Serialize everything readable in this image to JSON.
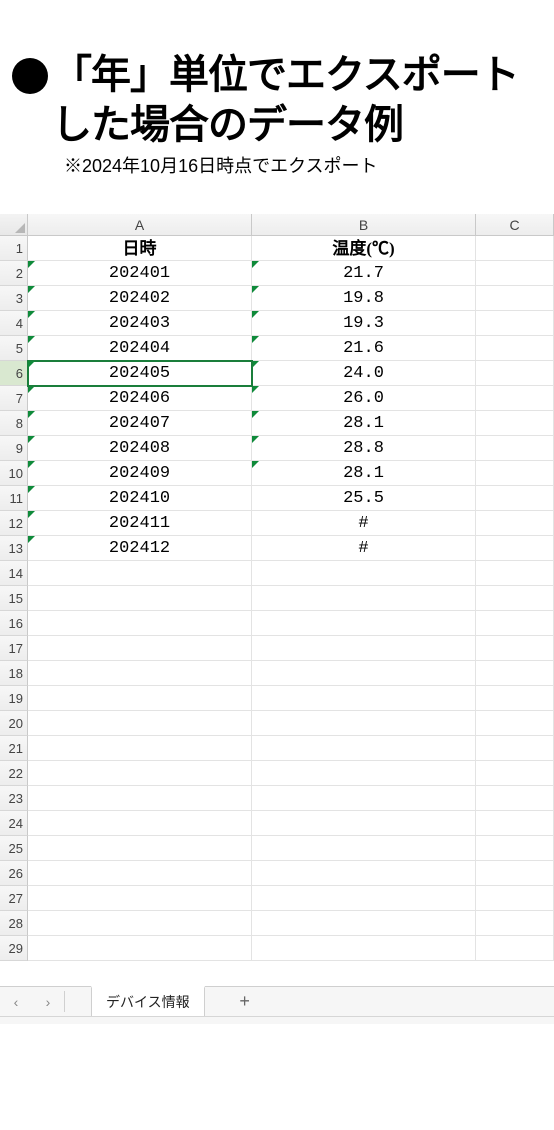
{
  "page": {
    "bullet": "●",
    "title": "「年」単位でエクスポートした場合のデータ例",
    "subtitle": "※2024年10月16日時点でエクスポート"
  },
  "sheet": {
    "columns": [
      "A",
      "B",
      "C"
    ],
    "headers": {
      "A": "日時",
      "B": "温度(℃)"
    },
    "selectedRow": 6,
    "rows": [
      {
        "n": 1,
        "A": "日時",
        "B": "温度(℃)",
        "isHeader": true,
        "flagA": false,
        "flagB": false
      },
      {
        "n": 2,
        "A": "202401",
        "B": "21.7",
        "flagA": true,
        "flagB": true
      },
      {
        "n": 3,
        "A": "202402",
        "B": "19.8",
        "flagA": true,
        "flagB": true
      },
      {
        "n": 4,
        "A": "202403",
        "B": "19.3",
        "flagA": true,
        "flagB": true
      },
      {
        "n": 5,
        "A": "202404",
        "B": "21.6",
        "flagA": true,
        "flagB": true
      },
      {
        "n": 6,
        "A": "202405",
        "B": "24.0",
        "flagA": true,
        "flagB": true
      },
      {
        "n": 7,
        "A": "202406",
        "B": "26.0",
        "flagA": true,
        "flagB": true
      },
      {
        "n": 8,
        "A": "202407",
        "B": "28.1",
        "flagA": true,
        "flagB": true
      },
      {
        "n": 9,
        "A": "202408",
        "B": "28.8",
        "flagA": true,
        "flagB": true
      },
      {
        "n": 10,
        "A": "202409",
        "B": "28.1",
        "flagA": true,
        "flagB": true
      },
      {
        "n": 11,
        "A": "202410",
        "B": "25.5",
        "flagA": true,
        "flagB": false
      },
      {
        "n": 12,
        "A": "202411",
        "B": "#",
        "flagA": true,
        "flagB": false
      },
      {
        "n": 13,
        "A": "202412",
        "B": "#",
        "flagA": true,
        "flagB": false
      },
      {
        "n": 14,
        "A": "",
        "B": ""
      },
      {
        "n": 15,
        "A": "",
        "B": ""
      },
      {
        "n": 16,
        "A": "",
        "B": ""
      },
      {
        "n": 17,
        "A": "",
        "B": ""
      },
      {
        "n": 18,
        "A": "",
        "B": ""
      },
      {
        "n": 19,
        "A": "",
        "B": ""
      },
      {
        "n": 20,
        "A": "",
        "B": ""
      },
      {
        "n": 21,
        "A": "",
        "B": ""
      },
      {
        "n": 22,
        "A": "",
        "B": ""
      },
      {
        "n": 23,
        "A": "",
        "B": ""
      },
      {
        "n": 24,
        "A": "",
        "B": ""
      },
      {
        "n": 25,
        "A": "",
        "B": ""
      },
      {
        "n": 26,
        "A": "",
        "B": ""
      },
      {
        "n": 27,
        "A": "",
        "B": ""
      },
      {
        "n": 28,
        "A": "",
        "B": ""
      },
      {
        "n": 29,
        "A": "",
        "B": ""
      }
    ],
    "tab": {
      "name": "デバイス情報",
      "nav_prev": "‹",
      "nav_next": "›",
      "add": "+"
    }
  },
  "chart_data": {
    "type": "table",
    "title": "「年」単位でエクスポートした場合のデータ例",
    "columns": [
      "日時",
      "温度(℃)"
    ],
    "rows": [
      [
        "202401",
        21.7
      ],
      [
        "202402",
        19.8
      ],
      [
        "202403",
        19.3
      ],
      [
        "202404",
        21.6
      ],
      [
        "202405",
        24.0
      ],
      [
        "202406",
        26.0
      ],
      [
        "202407",
        28.1
      ],
      [
        "202408",
        28.8
      ],
      [
        "202409",
        28.1
      ],
      [
        "202410",
        25.5
      ],
      [
        "202411",
        "#"
      ],
      [
        "202412",
        "#"
      ]
    ]
  }
}
